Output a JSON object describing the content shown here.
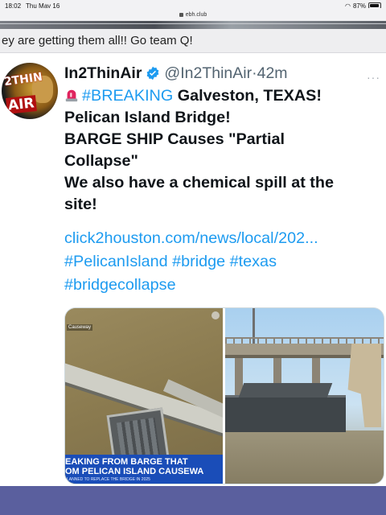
{
  "status_bar": {
    "time": "18:02",
    "date": "Thu May 16",
    "battery": "87%"
  },
  "browser": {
    "url": "ebh.club"
  },
  "caption": {
    "text": "ey are getting them all!!  Go team Q!"
  },
  "post": {
    "avatar_text_top": "2THIN",
    "avatar_text_bottom": "AIR",
    "display_name": "In2ThinAir",
    "handle": "@In2ThinAir",
    "separator": "·",
    "time_ago": "42m",
    "more": "···",
    "lines": {
      "breaking_tag": "#BREAKING",
      "line1_rest": "Galveston, TEXAS!",
      "line2": "Pelican Island Bridge!",
      "line3": "BARGE SHIP Causes \"Partial",
      "line4": "Collapse\"",
      "line5": "We also have a chemical spill at the",
      "line6": "site!"
    },
    "link": "click2houston.com/news/local/202...",
    "hashtags_line1": [
      "#PelicanIsland",
      "#bridge",
      "#texas"
    ],
    "hashtags_line2": [
      "#bridgecollapse"
    ],
    "media": {
      "left_label": "Causeway",
      "banner_line1": "EAKING FROM BARGE THAT",
      "banner_line2": "OM PELICAN ISLAND CAUSEWA",
      "banner_line3": "LANNED TO REPLACE THE BRIDGE IN 2025"
    }
  },
  "colors": {
    "accent": "#1d9bf0",
    "text": "#0f1419",
    "muted": "#536471",
    "news_banner": "#1a4db8"
  }
}
